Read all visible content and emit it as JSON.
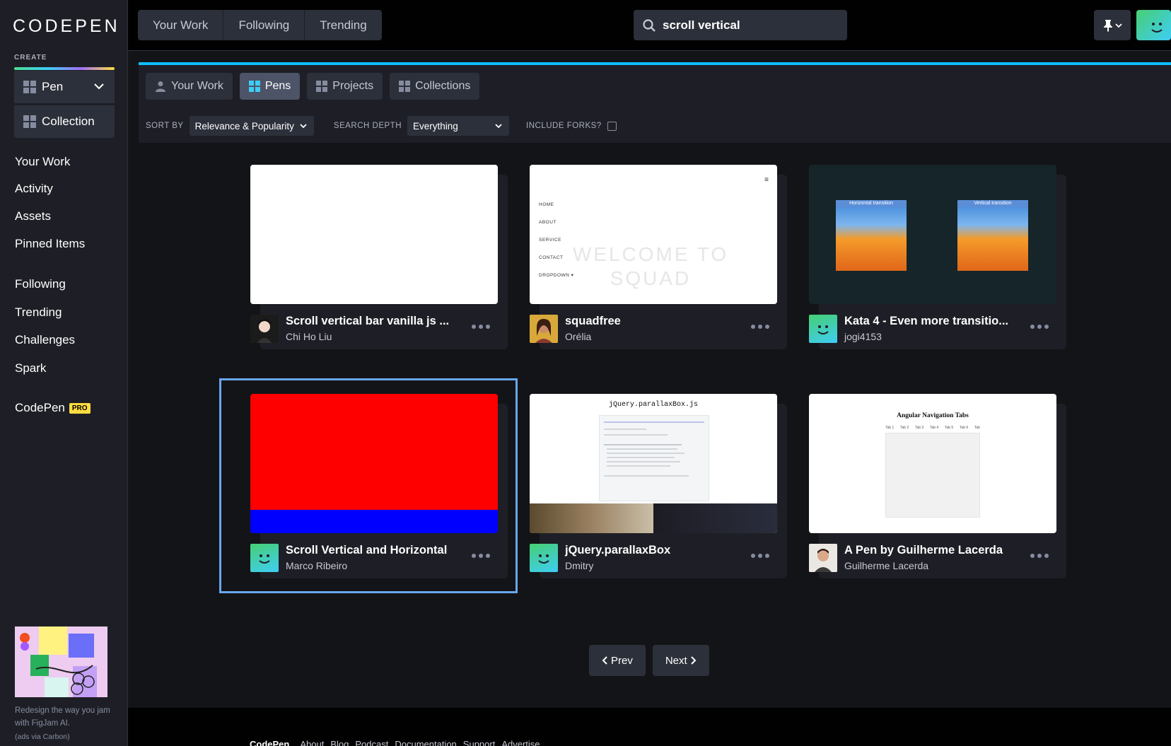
{
  "sidebar": {
    "logo": "CODEPEN",
    "create_label": "CREATE",
    "create_pen": "Pen",
    "create_collection": "Collection",
    "nav": {
      "your_work": "Your Work",
      "activity": "Activity",
      "assets": "Assets",
      "pinned": "Pinned Items",
      "following": "Following",
      "trending": "Trending",
      "challenges": "Challenges",
      "spark": "Spark",
      "codepen_pro": "CodePen",
      "pro_badge": "PRO"
    },
    "ad_text": "Redesign the way you jam with FigJam AI.",
    "ad_via": "(ads via Carbon)"
  },
  "header": {
    "tabs": [
      "Your Work",
      "Following",
      "Trending"
    ],
    "search_value": "scroll vertical"
  },
  "subnav": {
    "tabs": [
      "Your Work",
      "Pens",
      "Projects",
      "Collections"
    ],
    "sort_label": "SORT BY",
    "sort_value": "Relevance & Popularity",
    "depth_label": "SEARCH DEPTH",
    "depth_value": "Everything",
    "forks_label": "INCLUDE FORKS?"
  },
  "cards": [
    {
      "title": "Scroll vertical bar vanilla js ...",
      "author": "Chi Ho Liu"
    },
    {
      "title": "squadfree",
      "author": "Orélia"
    },
    {
      "title": "Kata 4 - Even more transitio...",
      "author": "jogi4153"
    },
    {
      "title": "Scroll Vertical and Horizontal",
      "author": "Marco Ribeiro"
    },
    {
      "title": "jQuery.parallaxBox",
      "author": "Dmitry"
    },
    {
      "title": "A Pen by Guilherme Lacerda",
      "author": "Guilherme Lacerda"
    }
  ],
  "thumbs": {
    "squad_menu": [
      "HOME",
      "ABOUT",
      "SERVICE",
      "CONTACT",
      "DROPDOWN ▾"
    ],
    "squad_hero": "WELCOME TO SQUAD",
    "kata_left": "Horizontal transition",
    "kata_right": "Vertical transition",
    "parallax_title": "jQuery.parallaxBox.js",
    "angular_title": "Angular Navigation Tabs",
    "angular_tabs": [
      "Tab 1",
      "Tab 2",
      "Tab 3",
      "Tab 4",
      "Tab 5",
      "Tab 6",
      "Tab"
    ]
  },
  "pager": {
    "prev": "Prev",
    "next": "Next"
  },
  "footer": {
    "brand": "CodePen",
    "links": [
      "About",
      "Blog",
      "Podcast",
      "Documentation",
      "Support",
      "Advertise"
    ]
  }
}
